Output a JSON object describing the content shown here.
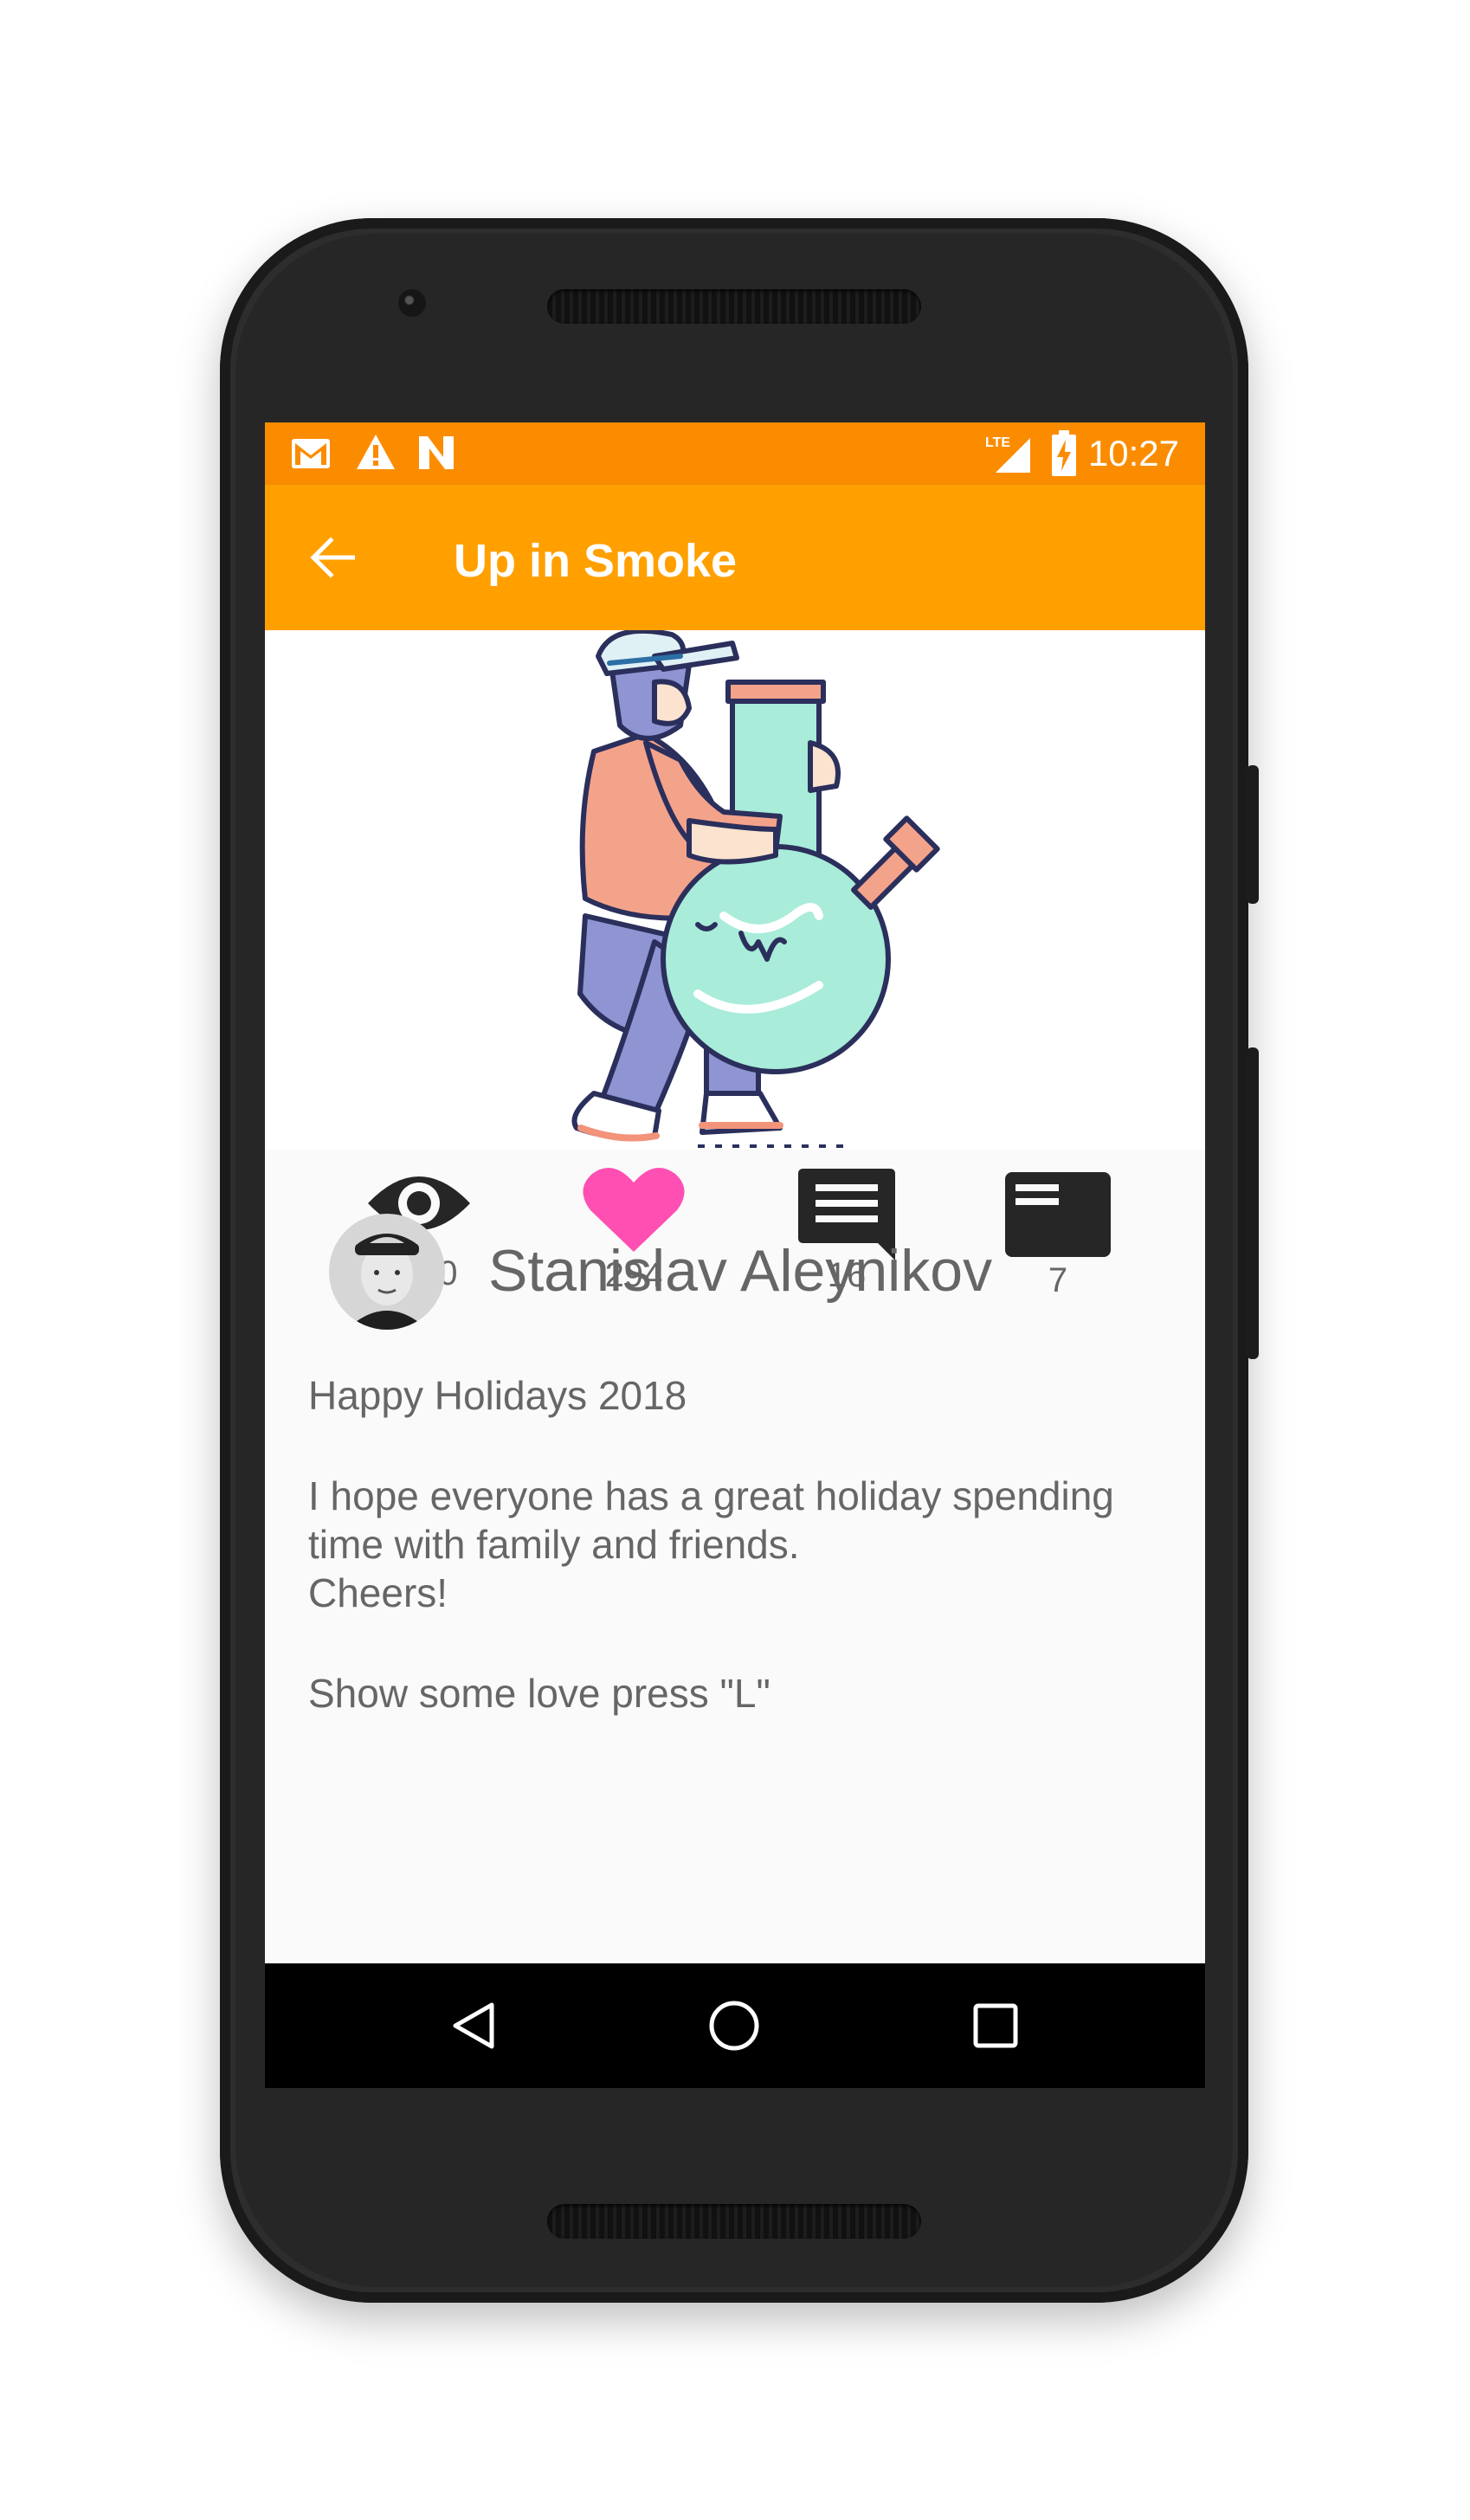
{
  "status_bar": {
    "time": "10:27",
    "icons": [
      "gmail-icon",
      "warning-icon",
      "n-notification-icon",
      "lte-signal-icon",
      "battery-charging-icon"
    ],
    "network_label": "LTE"
  },
  "toolbar": {
    "title": "Up in Smoke",
    "back_icon": "arrow-back-icon",
    "color": "#ffa000",
    "status_color": "#fb8c00"
  },
  "hero": {
    "image": "illustration-man-hugging-bong"
  },
  "stats": [
    {
      "icon": "eye-icon",
      "count": "2900"
    },
    {
      "icon": "heart-icon",
      "count": "294",
      "color": "#ff4fb3"
    },
    {
      "icon": "comment-icon",
      "count": "16"
    },
    {
      "icon": "card-icon",
      "count": "7"
    }
  ],
  "author": {
    "name": "Stanislav Aleynikov",
    "avatar": "avatar-photo"
  },
  "post": {
    "heading": "Happy Holidays 2018",
    "line1": "I hope everyone has a great holiday spending",
    "line2": "time with family and friends.",
    "line3": "Cheers!",
    "footer": "Show some love press \"L\""
  },
  "nav_bar": {
    "back": "nav-back-icon",
    "home": "nav-home-icon",
    "recents": "nav-recents-icon"
  }
}
